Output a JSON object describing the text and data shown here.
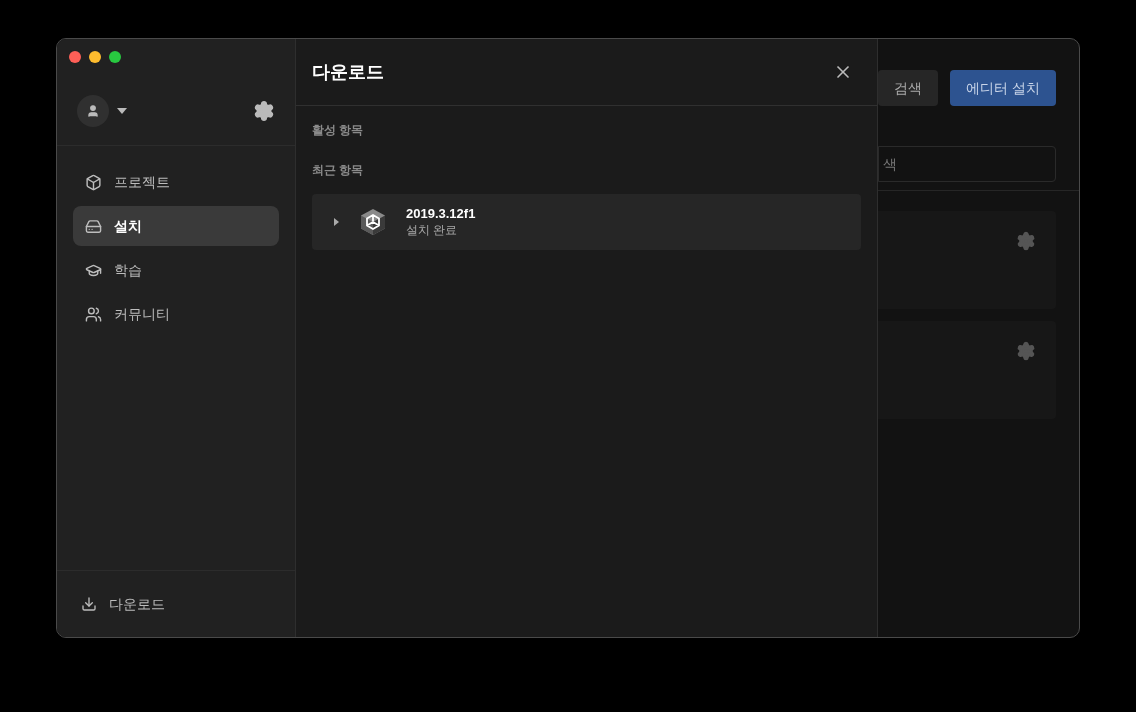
{
  "sidebar": {
    "nav": [
      {
        "label": "프로젝트",
        "selected": false
      },
      {
        "label": "설치",
        "selected": true
      },
      {
        "label": "학습",
        "selected": false
      },
      {
        "label": "커뮤니티",
        "selected": false
      }
    ],
    "footer": {
      "label": "다운로드"
    }
  },
  "downloads_panel": {
    "title": "다운로드",
    "sections": [
      {
        "heading": "활성 항목"
      },
      {
        "heading": "최근 항목",
        "items": [
          {
            "name": "2019.3.12f1",
            "status": "설치 완료",
            "expanded": false
          }
        ]
      }
    ]
  },
  "background": {
    "buttons": [
      {
        "label": "검색",
        "kind": "secondary"
      },
      {
        "label": "에디터 설치",
        "kind": "primary"
      }
    ],
    "search": {
      "placeholder": "색"
    }
  }
}
